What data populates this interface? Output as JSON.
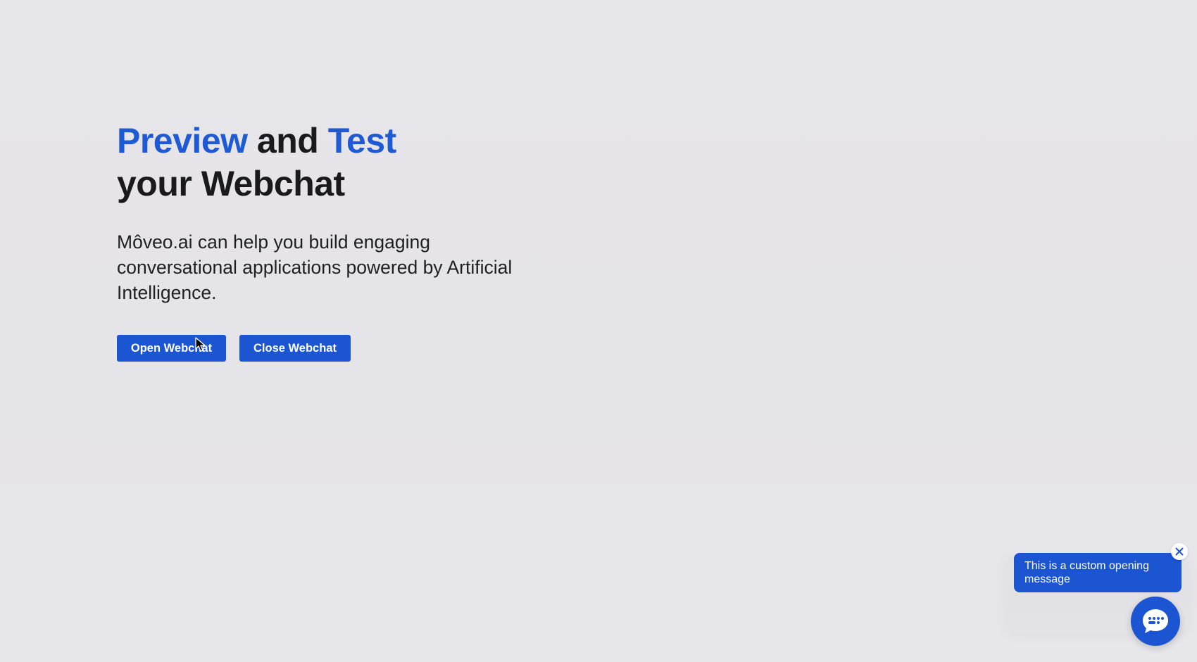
{
  "hero": {
    "title_word1": "Preview",
    "title_word2": " and ",
    "title_word3": "Test",
    "title_line2": "your Webchat",
    "description": "Môveo.ai can help you build engaging conversational applications powered by Artificial Intelligence."
  },
  "buttons": {
    "open_label": "Open Webchat",
    "close_label": "Close Webchat"
  },
  "webchat": {
    "opening_message": "This is a custom opening message",
    "close_icon": "close-icon",
    "launcher_icon": "chat-bubble-icon"
  },
  "colors": {
    "accent": "#1e5ad4",
    "button": "#1c55d1",
    "background": "#e6e5e8",
    "text": "#1a1a1c"
  }
}
